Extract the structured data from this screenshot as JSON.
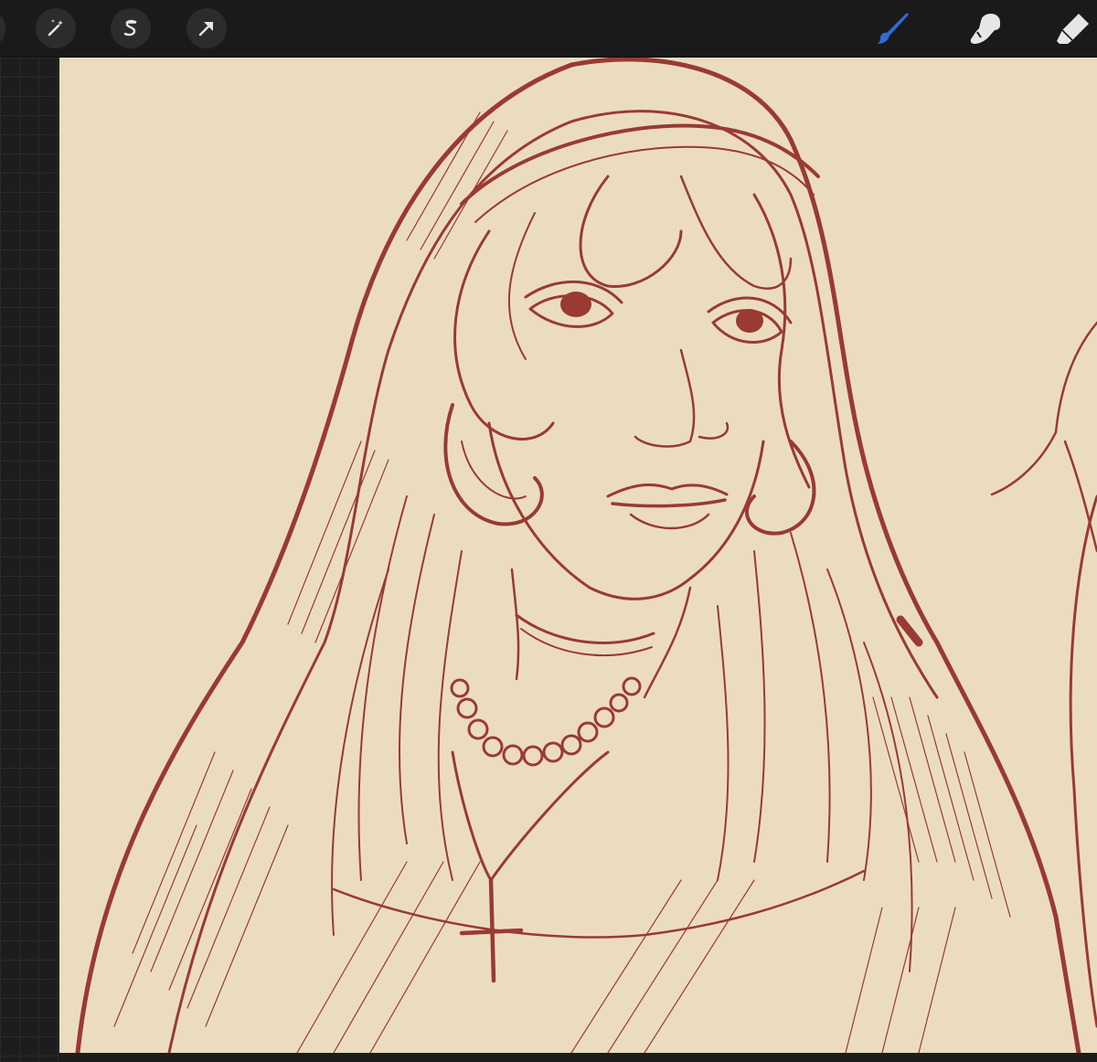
{
  "toolbar": {
    "left_tools": [
      {
        "name": "adjustments",
        "icon": "magic-wand-icon"
      },
      {
        "name": "selection",
        "icon": "selection-s-icon"
      },
      {
        "name": "transform",
        "icon": "arrow-cursor-icon"
      }
    ],
    "right_tools": [
      {
        "name": "brush",
        "icon": "brush-icon",
        "active": true
      },
      {
        "name": "smudge",
        "icon": "smudge-finger-icon",
        "active": false
      },
      {
        "name": "eraser",
        "icon": "eraser-icon",
        "active": false
      }
    ]
  },
  "colors": {
    "toolbar_bg": "#1a1a1a",
    "button_bg": "#2c2c2e",
    "icon": "#e6e6e6",
    "active_tool": "#2f6bd8",
    "canvas_bg": "#ebdcc0",
    "ink": "#9a3a32",
    "grid_bg": "#1d1d1f"
  },
  "canvas": {
    "subject": "sketch-nun-with-pearl-necklace-and-cross"
  }
}
